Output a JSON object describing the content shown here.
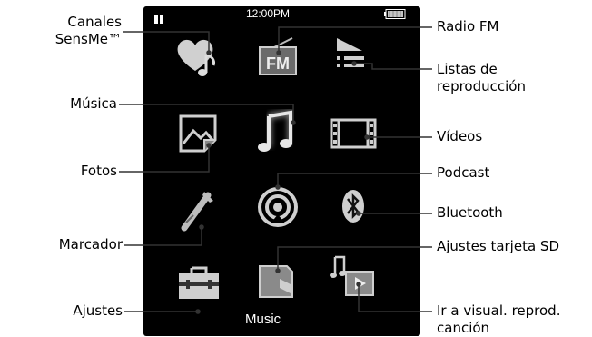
{
  "device": {
    "status_bar": {
      "time": "12:00PM"
    },
    "screen_title": "Music"
  },
  "callouts": {
    "sensme": [
      "Canales",
      "SensMe™"
    ],
    "radio": "Radio FM",
    "playlists": [
      "Listas de",
      "reproducción"
    ],
    "music": "Música",
    "videos": "Vídeos",
    "photos": "Fotos",
    "podcast": "Podcast",
    "bluetooth": "Bluetooth",
    "bookmark": "Marcador",
    "sdcard": "Ajustes tarjeta SD",
    "settings": "Ajustes",
    "now_playing": [
      "Ir a visual. reprod.",
      "canción"
    ]
  },
  "colors": {
    "screen_bg": "#000000",
    "icon_gray": "#d4d4d4",
    "icon_dark": "#5a5a5a",
    "line": "#333333"
  }
}
